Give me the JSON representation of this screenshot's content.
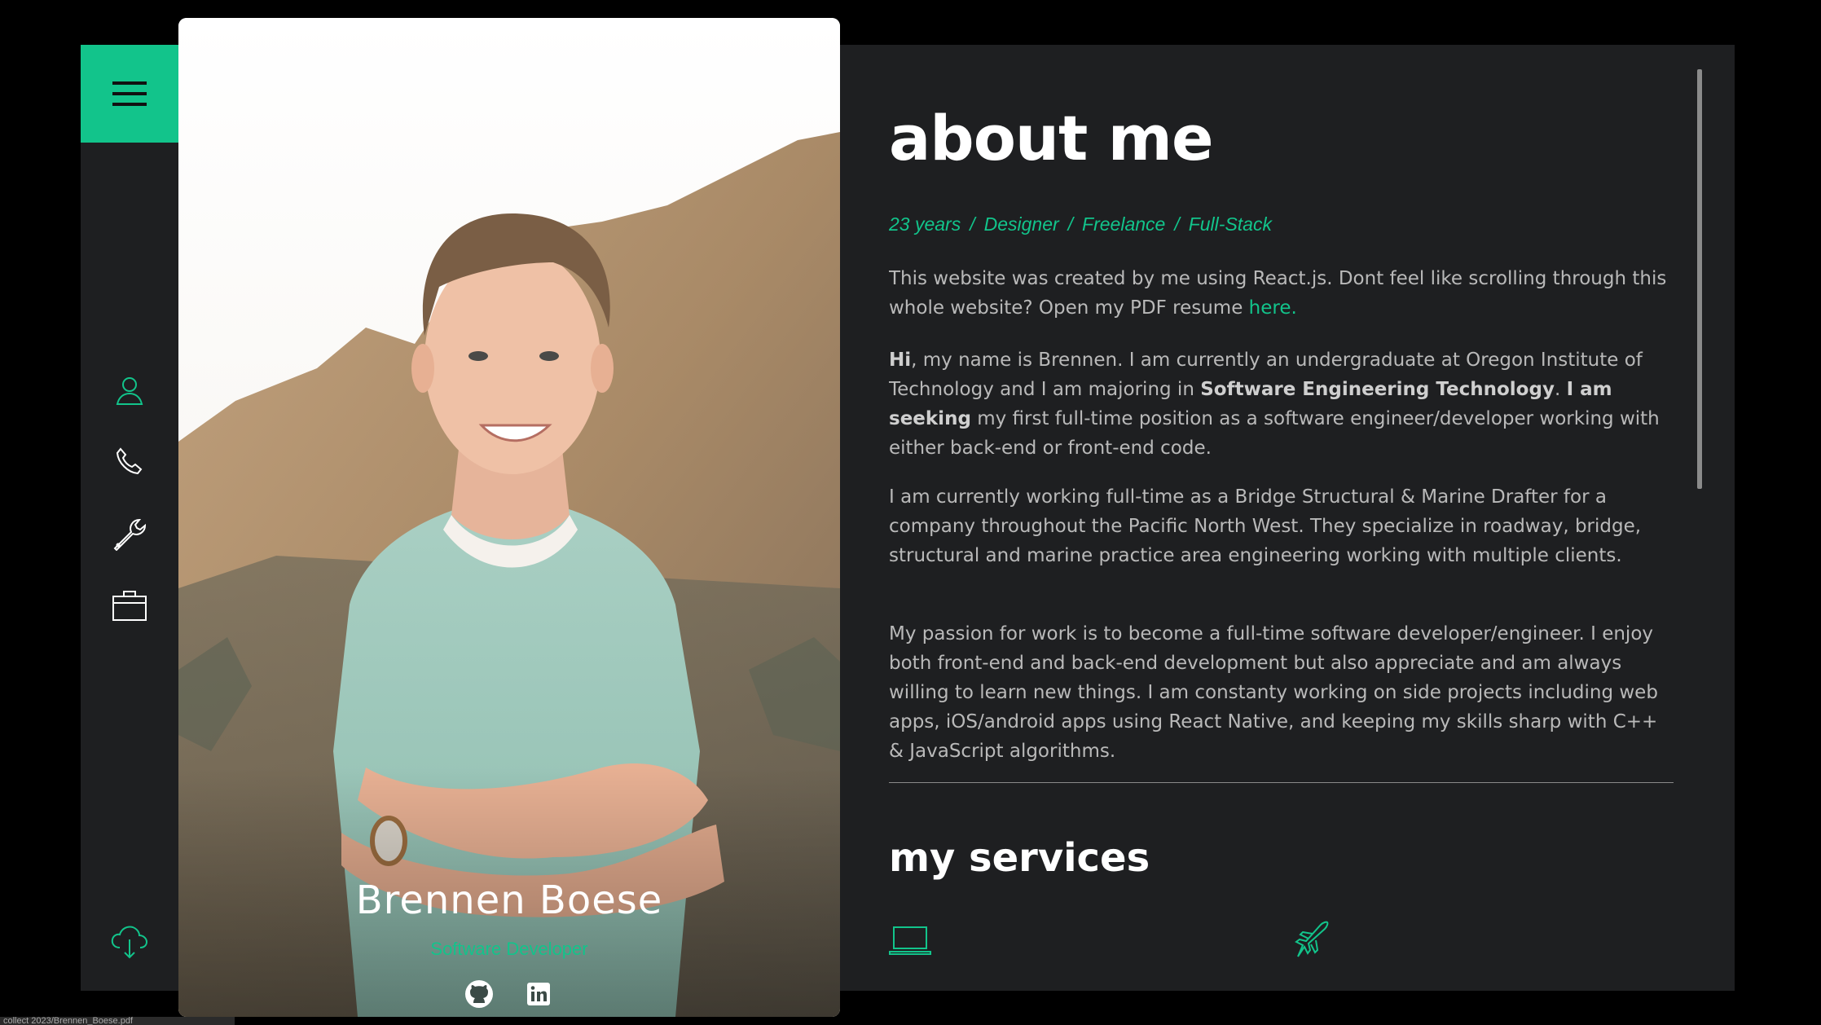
{
  "sidebar": {
    "menu_icon": "hamburger-menu-icon",
    "nav_items": [
      "user-icon",
      "phone-icon",
      "wrench-icon",
      "briefcase-icon"
    ],
    "bottom_icon": "cloud-download-icon"
  },
  "profile": {
    "name": "Brennen Boese",
    "role": "Software Developer",
    "social": [
      "github-icon",
      "linkedin-icon"
    ]
  },
  "about": {
    "title": "about me",
    "tags": [
      "23 years",
      "Designer",
      "Freelance",
      "Full-Stack"
    ],
    "tag_separator": "/",
    "p1_text": "This website was created by me using React.js. Dont feel like scrolling through this whole website? Open my PDF resume ",
    "p1_link": "here.",
    "p2_bold1": "Hi",
    "p2_text1": ", my name is Brennen. I am currently an undergraduate at Oregon Institute of Technology and I am majoring in ",
    "p2_bold2": "Software Engineering Technology",
    "p2_text2": ". ",
    "p2_bold3": "I am seeking",
    "p2_text3": " my first full-time position as a software engineer/developer working with either back-end or front-end code.",
    "p3": "I am currently working full-time as a Bridge Structural & Marine Drafter for a company throughout the Pacific North West. They specialize in roadway, bridge, structural and marine practice area engineering working with multiple clients.",
    "p4": "My passion for work is to become a full-time software developer/engineer. I enjoy both front-end and back-end development but also appreciate and am always willing to learn new things. I am constanty working on side projects including web apps, iOS/android apps using React Native, and keeping my skills sharp with C++ & JavaScript algorithms."
  },
  "services": {
    "title": "my services",
    "icons": [
      "laptop-icon",
      "jet-icon"
    ]
  },
  "status_bar": "collect 2023/Brennen_Boese.pdf",
  "colors": {
    "accent": "#12c48b",
    "panel": "#1e1f21",
    "text": "#b9b9b9"
  }
}
